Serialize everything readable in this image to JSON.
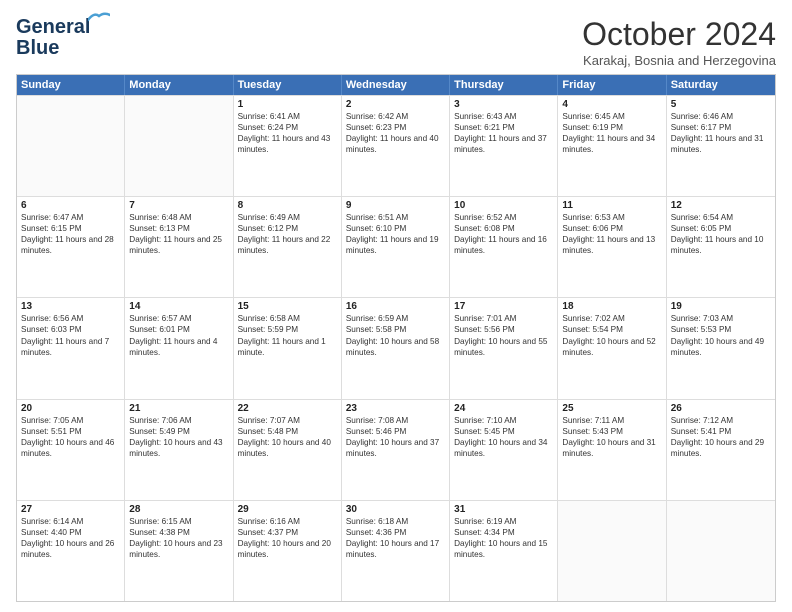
{
  "logo": {
    "line1": "General",
    "line2": "Blue"
  },
  "header": {
    "month": "October 2024",
    "location": "Karakaj, Bosnia and Herzegovina"
  },
  "days_of_week": [
    "Sunday",
    "Monday",
    "Tuesday",
    "Wednesday",
    "Thursday",
    "Friday",
    "Saturday"
  ],
  "weeks": [
    [
      {
        "day": "",
        "sunrise": "",
        "sunset": "",
        "daylight": ""
      },
      {
        "day": "",
        "sunrise": "",
        "sunset": "",
        "daylight": ""
      },
      {
        "day": "1",
        "sunrise": "Sunrise: 6:41 AM",
        "sunset": "Sunset: 6:24 PM",
        "daylight": "Daylight: 11 hours and 43 minutes."
      },
      {
        "day": "2",
        "sunrise": "Sunrise: 6:42 AM",
        "sunset": "Sunset: 6:23 PM",
        "daylight": "Daylight: 11 hours and 40 minutes."
      },
      {
        "day": "3",
        "sunrise": "Sunrise: 6:43 AM",
        "sunset": "Sunset: 6:21 PM",
        "daylight": "Daylight: 11 hours and 37 minutes."
      },
      {
        "day": "4",
        "sunrise": "Sunrise: 6:45 AM",
        "sunset": "Sunset: 6:19 PM",
        "daylight": "Daylight: 11 hours and 34 minutes."
      },
      {
        "day": "5",
        "sunrise": "Sunrise: 6:46 AM",
        "sunset": "Sunset: 6:17 PM",
        "daylight": "Daylight: 11 hours and 31 minutes."
      }
    ],
    [
      {
        "day": "6",
        "sunrise": "Sunrise: 6:47 AM",
        "sunset": "Sunset: 6:15 PM",
        "daylight": "Daylight: 11 hours and 28 minutes."
      },
      {
        "day": "7",
        "sunrise": "Sunrise: 6:48 AM",
        "sunset": "Sunset: 6:13 PM",
        "daylight": "Daylight: 11 hours and 25 minutes."
      },
      {
        "day": "8",
        "sunrise": "Sunrise: 6:49 AM",
        "sunset": "Sunset: 6:12 PM",
        "daylight": "Daylight: 11 hours and 22 minutes."
      },
      {
        "day": "9",
        "sunrise": "Sunrise: 6:51 AM",
        "sunset": "Sunset: 6:10 PM",
        "daylight": "Daylight: 11 hours and 19 minutes."
      },
      {
        "day": "10",
        "sunrise": "Sunrise: 6:52 AM",
        "sunset": "Sunset: 6:08 PM",
        "daylight": "Daylight: 11 hours and 16 minutes."
      },
      {
        "day": "11",
        "sunrise": "Sunrise: 6:53 AM",
        "sunset": "Sunset: 6:06 PM",
        "daylight": "Daylight: 11 hours and 13 minutes."
      },
      {
        "day": "12",
        "sunrise": "Sunrise: 6:54 AM",
        "sunset": "Sunset: 6:05 PM",
        "daylight": "Daylight: 11 hours and 10 minutes."
      }
    ],
    [
      {
        "day": "13",
        "sunrise": "Sunrise: 6:56 AM",
        "sunset": "Sunset: 6:03 PM",
        "daylight": "Daylight: 11 hours and 7 minutes."
      },
      {
        "day": "14",
        "sunrise": "Sunrise: 6:57 AM",
        "sunset": "Sunset: 6:01 PM",
        "daylight": "Daylight: 11 hours and 4 minutes."
      },
      {
        "day": "15",
        "sunrise": "Sunrise: 6:58 AM",
        "sunset": "Sunset: 5:59 PM",
        "daylight": "Daylight: 11 hours and 1 minute."
      },
      {
        "day": "16",
        "sunrise": "Sunrise: 6:59 AM",
        "sunset": "Sunset: 5:58 PM",
        "daylight": "Daylight: 10 hours and 58 minutes."
      },
      {
        "day": "17",
        "sunrise": "Sunrise: 7:01 AM",
        "sunset": "Sunset: 5:56 PM",
        "daylight": "Daylight: 10 hours and 55 minutes."
      },
      {
        "day": "18",
        "sunrise": "Sunrise: 7:02 AM",
        "sunset": "Sunset: 5:54 PM",
        "daylight": "Daylight: 10 hours and 52 minutes."
      },
      {
        "day": "19",
        "sunrise": "Sunrise: 7:03 AM",
        "sunset": "Sunset: 5:53 PM",
        "daylight": "Daylight: 10 hours and 49 minutes."
      }
    ],
    [
      {
        "day": "20",
        "sunrise": "Sunrise: 7:05 AM",
        "sunset": "Sunset: 5:51 PM",
        "daylight": "Daylight: 10 hours and 46 minutes."
      },
      {
        "day": "21",
        "sunrise": "Sunrise: 7:06 AM",
        "sunset": "Sunset: 5:49 PM",
        "daylight": "Daylight: 10 hours and 43 minutes."
      },
      {
        "day": "22",
        "sunrise": "Sunrise: 7:07 AM",
        "sunset": "Sunset: 5:48 PM",
        "daylight": "Daylight: 10 hours and 40 minutes."
      },
      {
        "day": "23",
        "sunrise": "Sunrise: 7:08 AM",
        "sunset": "Sunset: 5:46 PM",
        "daylight": "Daylight: 10 hours and 37 minutes."
      },
      {
        "day": "24",
        "sunrise": "Sunrise: 7:10 AM",
        "sunset": "Sunset: 5:45 PM",
        "daylight": "Daylight: 10 hours and 34 minutes."
      },
      {
        "day": "25",
        "sunrise": "Sunrise: 7:11 AM",
        "sunset": "Sunset: 5:43 PM",
        "daylight": "Daylight: 10 hours and 31 minutes."
      },
      {
        "day": "26",
        "sunrise": "Sunrise: 7:12 AM",
        "sunset": "Sunset: 5:41 PM",
        "daylight": "Daylight: 10 hours and 29 minutes."
      }
    ],
    [
      {
        "day": "27",
        "sunrise": "Sunrise: 6:14 AM",
        "sunset": "Sunset: 4:40 PM",
        "daylight": "Daylight: 10 hours and 26 minutes."
      },
      {
        "day": "28",
        "sunrise": "Sunrise: 6:15 AM",
        "sunset": "Sunset: 4:38 PM",
        "daylight": "Daylight: 10 hours and 23 minutes."
      },
      {
        "day": "29",
        "sunrise": "Sunrise: 6:16 AM",
        "sunset": "Sunset: 4:37 PM",
        "daylight": "Daylight: 10 hours and 20 minutes."
      },
      {
        "day": "30",
        "sunrise": "Sunrise: 6:18 AM",
        "sunset": "Sunset: 4:36 PM",
        "daylight": "Daylight: 10 hours and 17 minutes."
      },
      {
        "day": "31",
        "sunrise": "Sunrise: 6:19 AM",
        "sunset": "Sunset: 4:34 PM",
        "daylight": "Daylight: 10 hours and 15 minutes."
      },
      {
        "day": "",
        "sunrise": "",
        "sunset": "",
        "daylight": ""
      },
      {
        "day": "",
        "sunrise": "",
        "sunset": "",
        "daylight": ""
      }
    ]
  ]
}
